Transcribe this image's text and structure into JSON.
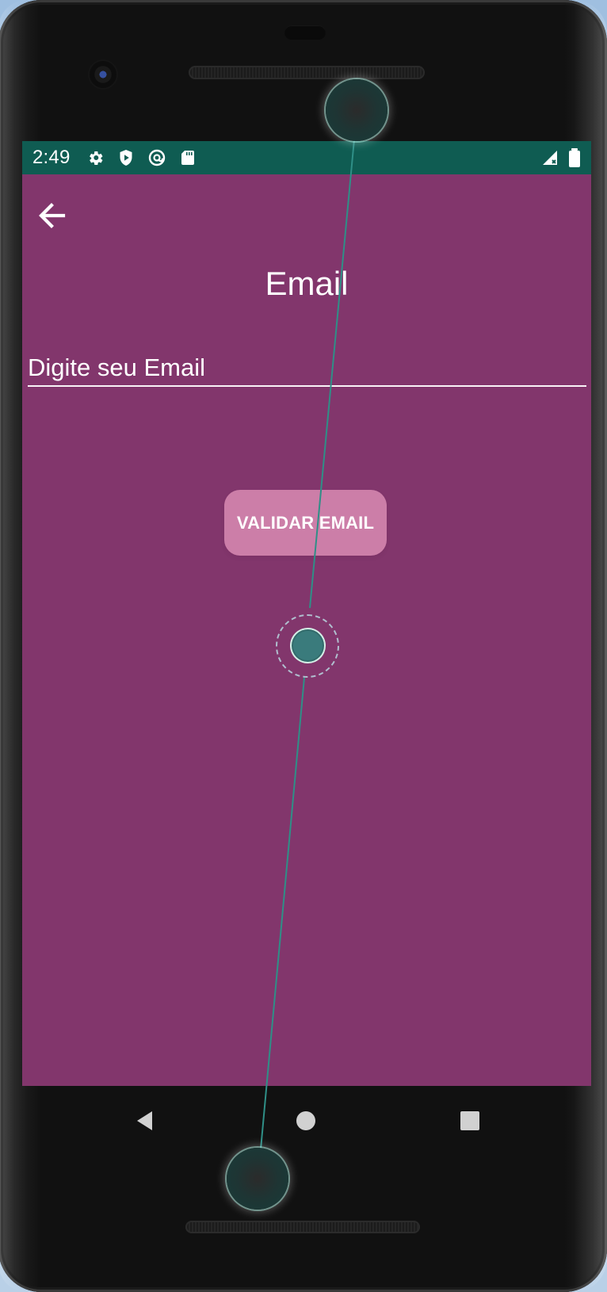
{
  "status_bar": {
    "time": "2:49",
    "left_icons": [
      "gear-icon",
      "shield-play-icon",
      "sync-at-icon",
      "sd-card-icon"
    ],
    "right_icons": [
      "signal-x-icon",
      "battery-icon"
    ],
    "background_color": "#0f5c52"
  },
  "screen": {
    "background_color": "#82366c",
    "back_icon": "arrow-left-icon",
    "title": "Email",
    "email_input": {
      "value": "",
      "placeholder": "Digite seu Email"
    },
    "validate_button_label": "VALIDAR EMAIL",
    "button_color": "#cc7ea8"
  },
  "navigation": {
    "back_icon": "triangle-back-icon",
    "home_icon": "circle-home-icon",
    "recents_icon": "square-recents-icon"
  },
  "overlay": {
    "touch_indicator_color": "#2f8f87"
  }
}
